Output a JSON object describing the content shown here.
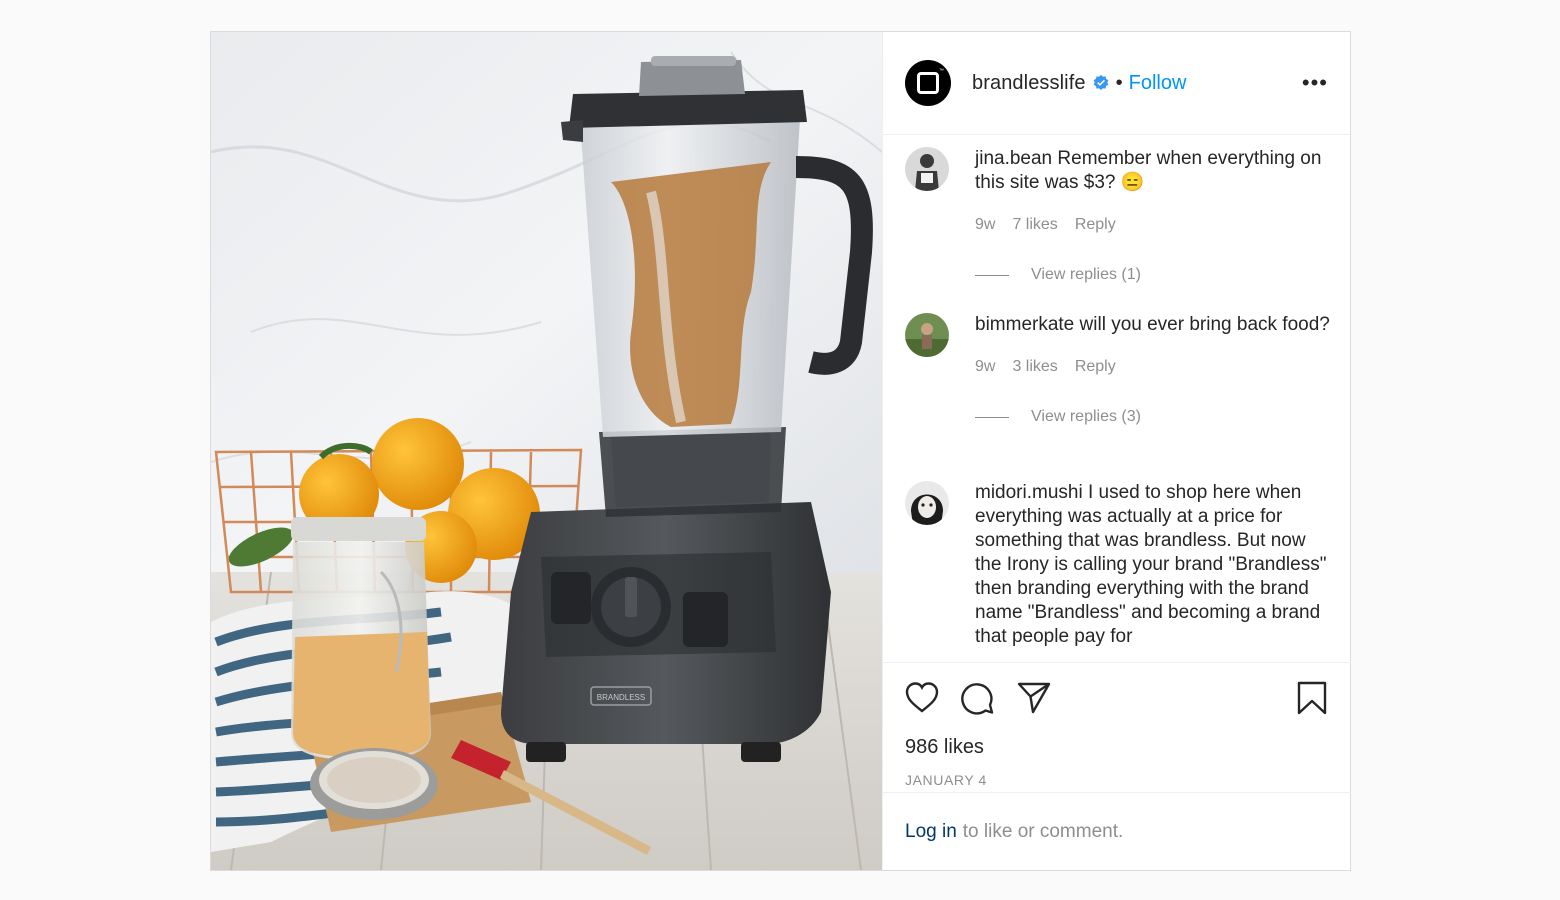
{
  "post": {
    "username": "brandlesslife",
    "separator": "•",
    "follow_label": "Follow",
    "more_label": "•••",
    "logo_mark": "™",
    "photo_brand": "BRANDLESS"
  },
  "comments": [
    {
      "username": "jina.bean",
      "text": "Remember when everything on this site was $3? 😑",
      "age": "9w",
      "likes": "7 likes",
      "reply_label": "Reply",
      "view_replies": "View replies (1)"
    },
    {
      "username": "bimmerkate",
      "text": "will you ever bring back food?",
      "age": "9w",
      "likes": "3 likes",
      "reply_label": "Reply",
      "view_replies": "View replies (3)"
    },
    {
      "username": "midori.mushi",
      "text": "I used to shop here when everything was actually at a price for something that was brandless. But now the Irony is calling your brand \"Brandless\" then branding everything with the brand name \"Brandless\" and becoming a brand that people pay for"
    }
  ],
  "footer": {
    "likes": "986 likes",
    "date": "JANUARY 4",
    "login_link": "Log in",
    "login_text": "to like or comment."
  },
  "icons": {
    "like": "heart-icon",
    "comment": "comment-icon",
    "share": "paper-plane-icon",
    "save": "bookmark-icon",
    "verified": "verified-badge-icon",
    "more": "more-options-icon"
  },
  "colors": {
    "link": "#0095f6",
    "muted": "#8e8e8e",
    "text": "#262626",
    "login_link": "#00376b"
  }
}
